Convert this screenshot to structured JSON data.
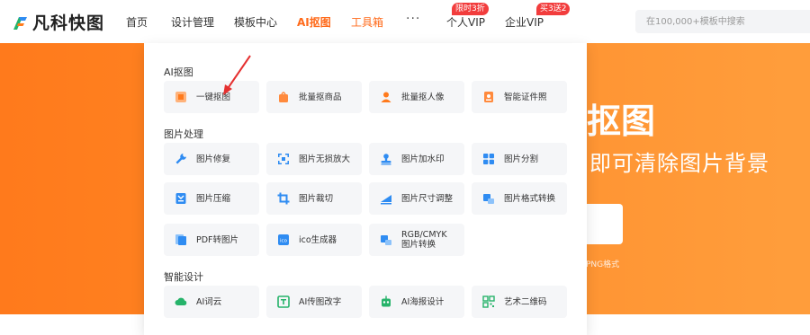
{
  "header": {
    "brand": "凡科快图",
    "nav": [
      "首页",
      "设计管理",
      "模板中心",
      "AI抠图",
      "工具箱",
      "···",
      "个人VIP",
      "企业VIP"
    ],
    "badges": {
      "personal_vip": "限时3折",
      "enterprise_vip": "买3送2"
    },
    "search_placeholder": "在100,000+模板中搜索"
  },
  "hero": {
    "title": "抠图",
    "subtitle": "即可清除图片背景",
    "format_note": "PNG格式"
  },
  "menu": {
    "sections": [
      {
        "title": "AI抠图",
        "items": [
          "一键抠图",
          "批量抠商品",
          "批量抠人像",
          "智能证件照"
        ]
      },
      {
        "title": "图片处理",
        "items": [
          "图片修复",
          "图片无损放大",
          "图片加水印",
          "图片分割",
          "图片压缩",
          "图片裁切",
          "图片尺寸调整",
          "图片格式转换",
          "PDF转图片",
          "ico生成器",
          "RGB/CMYK",
          "图片转换"
        ]
      },
      {
        "title": "智能设计",
        "items": [
          "AI词云",
          "AI传图改字",
          "AI海报设计",
          "艺术二维码"
        ]
      }
    ]
  },
  "colors": {
    "accent": "#ff6a1a",
    "brand_orange": "#ff7a1c",
    "badge_red": "#f23d3d",
    "tile_bg": "#f5f6f8",
    "icon_blue": "#2f8cf2",
    "icon_green": "#26b36a"
  }
}
